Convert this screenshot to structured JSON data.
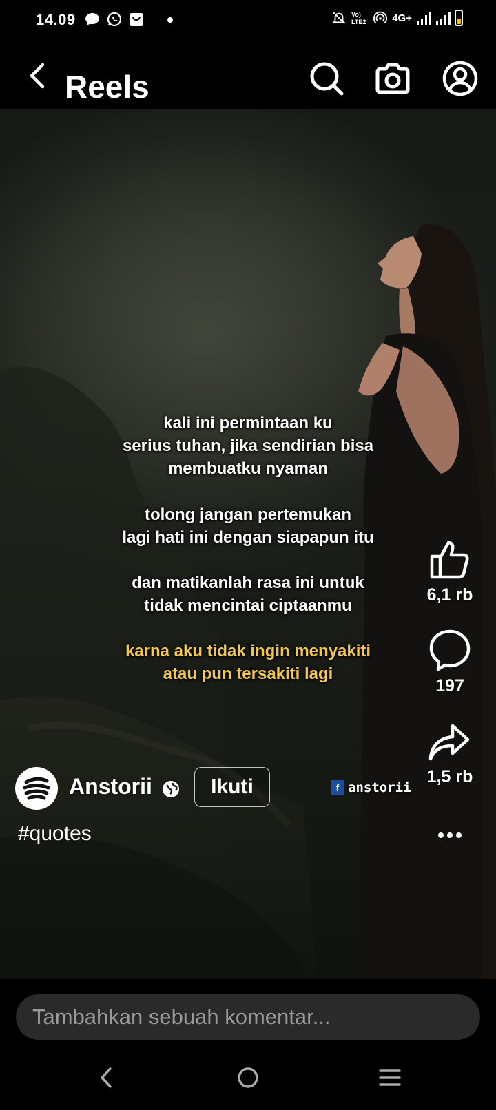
{
  "status_bar": {
    "time": "14.09",
    "network": "4G+",
    "icons": [
      "chat-icon",
      "whatsapp-icon",
      "shopping-bag-icon",
      "notification-dot",
      "mute-bell-icon",
      "volte-icon",
      "hotspot-icon",
      "signal-icon",
      "signal-icon",
      "battery-icon"
    ]
  },
  "header": {
    "title": "Reels",
    "icons": [
      "back-icon",
      "search-icon",
      "camera-icon",
      "profile-icon"
    ]
  },
  "reel": {
    "caption_paragraphs": [
      "kali ini permintaan ku\nserius tuhan, jika sendirian bisa\nmembuatku nyaman",
      "tolong jangan pertemukan\nlagi hati ini dengan siapapun itu",
      "dan matikanlah rasa ini untuk\ntidak mencintai ciptaanmu",
      "karna aku tidak ingin menyakiti\natau pun tersakiti lagi"
    ],
    "highlight_color": "#f2c74d",
    "watermark": {
      "badge": "f",
      "name": "anstorii"
    },
    "actions": {
      "likes": "6,1 rb",
      "comments": "197",
      "shares": "1,5 rb"
    },
    "author": {
      "name": "Anstorii",
      "follow_label": "Ikuti"
    },
    "hashtag": "#quotes"
  },
  "comment_bar": {
    "placeholder": "Tambahkan sebuah komentar..."
  },
  "nav_bar": {
    "icons": [
      "nav-back-icon",
      "nav-home-icon",
      "nav-recents-icon"
    ]
  }
}
